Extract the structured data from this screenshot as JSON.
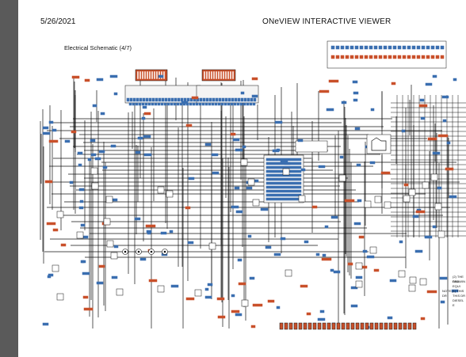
{
  "header": {
    "date": "5/26/2021",
    "viewer_title": "ONeVIEW INTERACTIVE VIEWER"
  },
  "document": {
    "schematic_title": "Electrical Schematic (4/7)",
    "notes": [
      "(2)  THE PAG",
      "DRAWIN",
      "EQUI",
      "NOTE (1)  THIS DR",
      "THIS DR",
      "DIESEL E"
    ]
  },
  "colors": {
    "wire": "#111111",
    "connector": "#3a6fb0",
    "connector_accent": "#c9502a",
    "page_bg": "#ffffff",
    "viewer_bg": "#5a5a5a"
  }
}
